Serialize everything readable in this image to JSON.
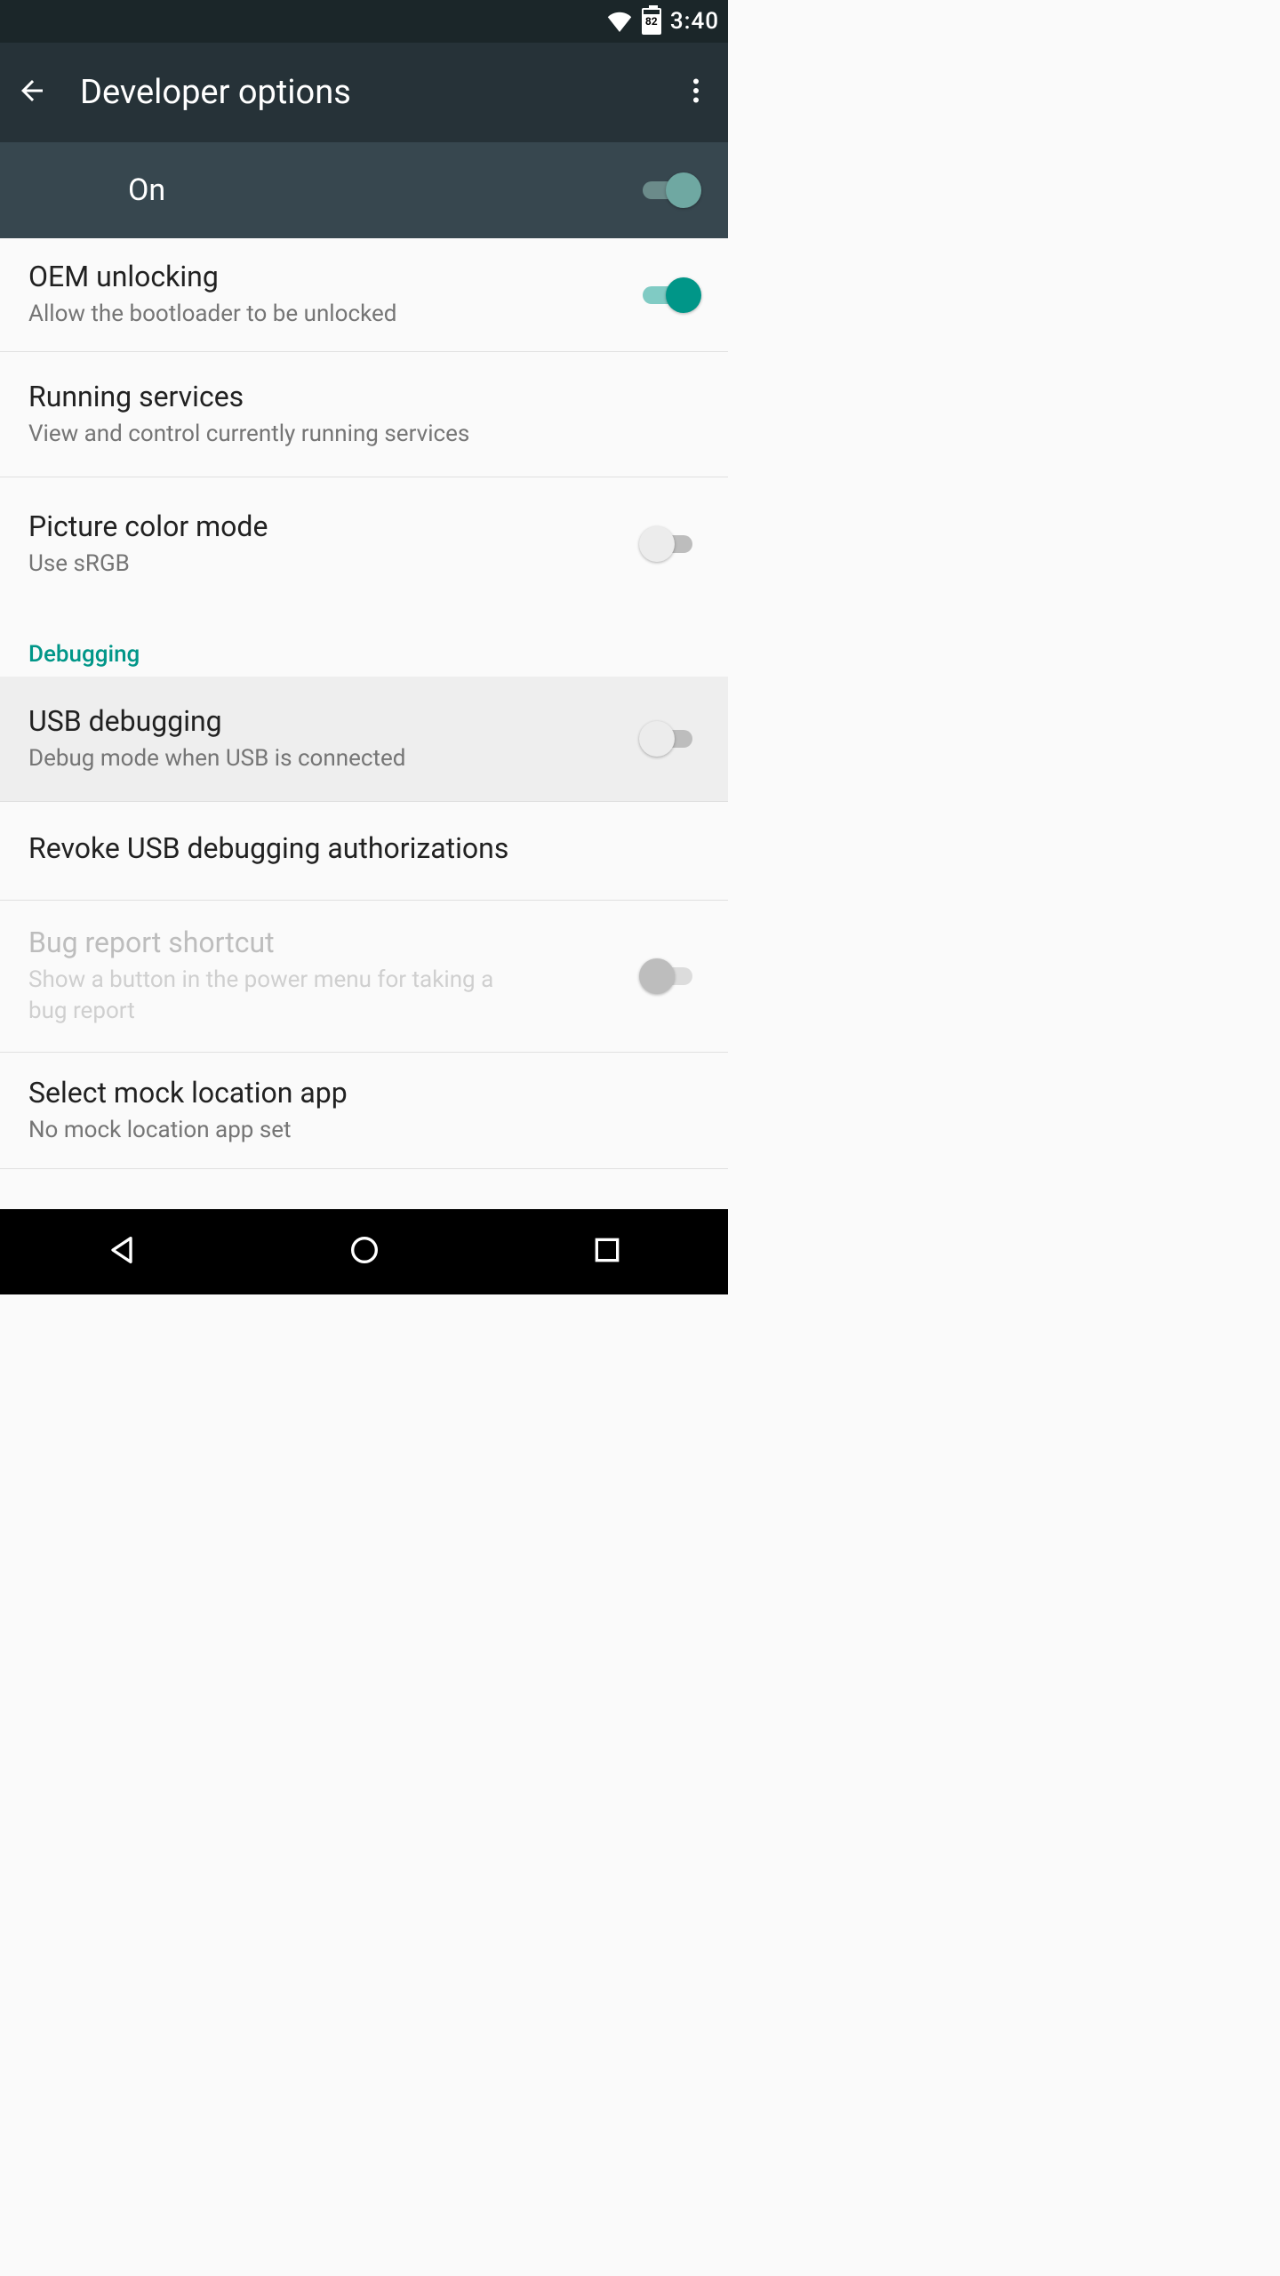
{
  "status": {
    "battery_pct": "82",
    "time": "3:40"
  },
  "appbar": {
    "title": "Developer options"
  },
  "master": {
    "label": "On",
    "on": true
  },
  "rows": {
    "oem": {
      "title": "OEM unlocking",
      "subtitle": "Allow the bootloader to be unlocked",
      "on": true
    },
    "running": {
      "title": "Running services",
      "subtitle": "View and control currently running services"
    },
    "picture": {
      "title": "Picture color mode",
      "subtitle": "Use sRGB",
      "on": false
    }
  },
  "section_debugging": "Debugging",
  "debug_rows": {
    "usb": {
      "title": "USB debugging",
      "subtitle": "Debug mode when USB is connected",
      "on": false
    },
    "revoke": {
      "title": "Revoke USB debugging authorizations"
    },
    "bugreport": {
      "title": "Bug report shortcut",
      "subtitle": "Show a button in the power menu for taking a bug report",
      "on": false,
      "disabled": true
    },
    "mock": {
      "title": "Select mock location app",
      "subtitle": "No mock location app set"
    }
  }
}
